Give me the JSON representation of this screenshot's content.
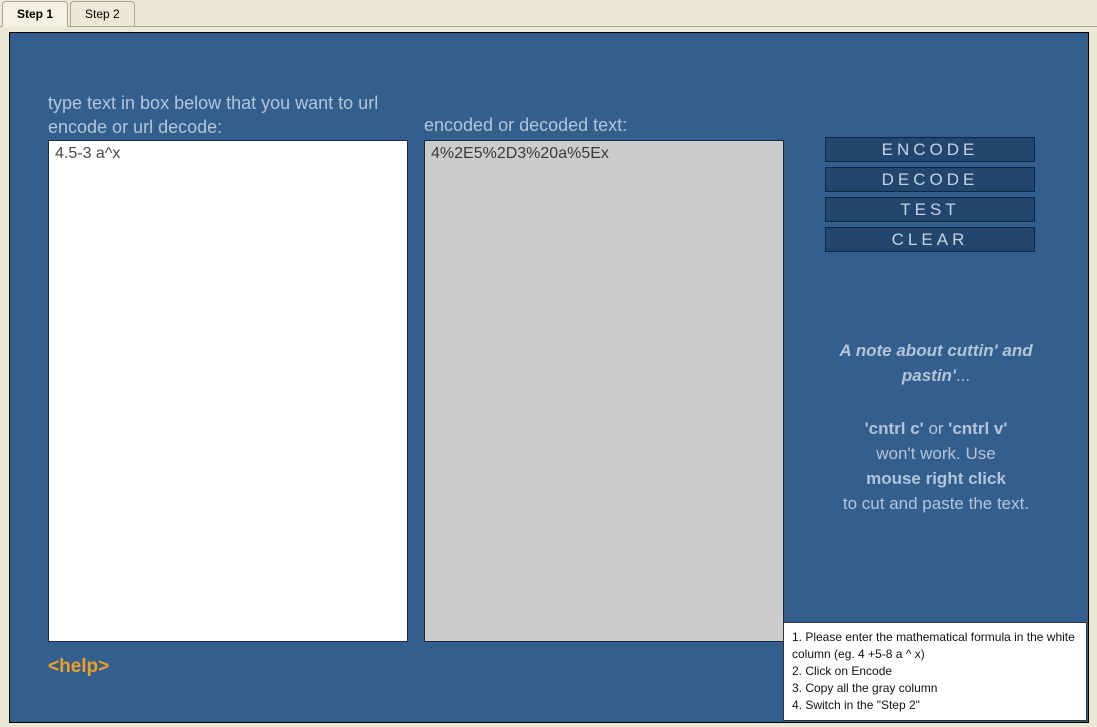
{
  "tabs": {
    "step1": "Step 1",
    "step2": "Step 2"
  },
  "labels": {
    "input_label": "type text in box below that you want to url encode or url decode:",
    "output_label": "encoded or decoded text:"
  },
  "textboxes": {
    "input_value": "4.5-3 a^x",
    "output_value": "4%2E5%2D3%20a%5Ex"
  },
  "buttons": {
    "encode": "ENCODE",
    "decode": "DECODE",
    "test": "TEST",
    "clear": "CLEAR"
  },
  "note": {
    "title": "A note about cuttin' and pastin'",
    "title_suffix": "...",
    "line1_part1": "'cntrl c'",
    "line1_mid": " or ",
    "line1_part2": "'cntrl v'",
    "line2": "won't work.  Use",
    "line3": "mouse right click",
    "line4": "to cut and paste the text."
  },
  "help": {
    "label": "<help>"
  },
  "tooltip": {
    "line1": "1. Please enter the mathematical formula in the white column (eg. 4 +5-8 a ^ x)",
    "line2": "2. Click on Encode",
    "line3": "3. Copy all the gray column",
    "line4": "4. Switch in the \"Step 2\""
  }
}
